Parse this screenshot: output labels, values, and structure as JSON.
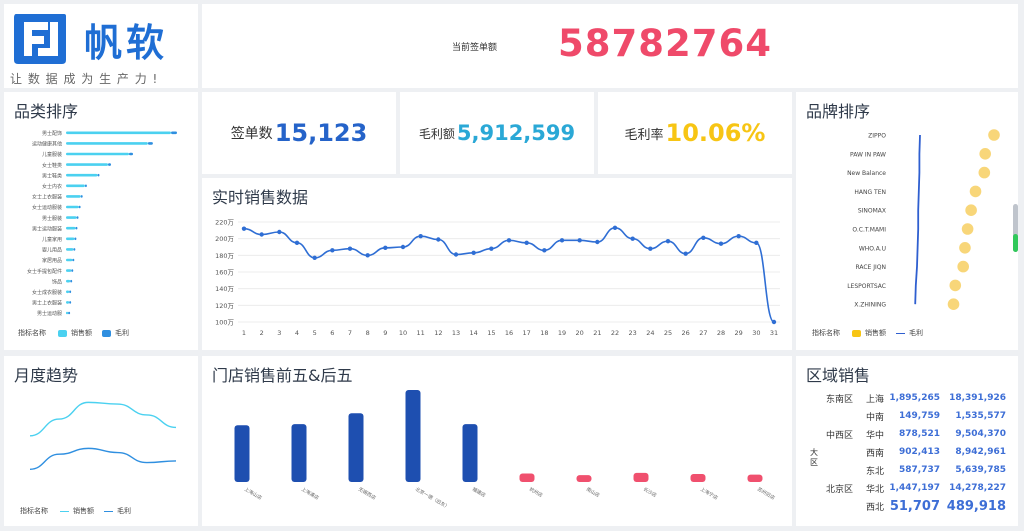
{
  "logo": {
    "brand": "帆软",
    "slogan": "让 数 据 成 为 生 产 力 !"
  },
  "header": {
    "label": "当前签单额",
    "value": "58782764"
  },
  "kpis": {
    "orders_label": "签单数",
    "orders_value": "15,123",
    "profit_label": "毛利额",
    "profit_value": "5,912,599",
    "margin_label": "毛利率",
    "margin_value": "10.06%"
  },
  "category_rank": {
    "title": "品类排序",
    "categories": [
      "男士配饰",
      "运动健康其他",
      "儿童服装",
      "女士鞋类",
      "男士鞋类",
      "女士内衣",
      "女士上衣服装",
      "女士运动服装",
      "男士服装",
      "男士运动服装",
      "儿童家用",
      "婴儿用品",
      "家居用品",
      "女士手提包配件",
      "饰品",
      "女士成衣服装",
      "男士上衣服装",
      "男士运动服"
    ],
    "legend_title": "指标名称",
    "legend_sales": "销售额",
    "legend_profit": "毛利"
  },
  "realtime": {
    "title": "实时销售数据",
    "y_ticks": [
      "220万",
      "200万",
      "180万",
      "160万",
      "140万",
      "120万",
      "100万"
    ],
    "x_ticks": [
      "1",
      "2",
      "3",
      "4",
      "5",
      "6",
      "7",
      "8",
      "9",
      "10",
      "11",
      "12",
      "13",
      "14",
      "15",
      "16",
      "17",
      "18",
      "19",
      "20",
      "21",
      "22",
      "23",
      "24",
      "25",
      "26",
      "27",
      "28",
      "29",
      "30",
      "31"
    ]
  },
  "brand_rank": {
    "title": "品牌排序",
    "brands": [
      "ZIPPO",
      "PAW IN PAW",
      "New Balance",
      "HANG TEN",
      "SINOMAX",
      "O.C.T.MAMI",
      "WHO.A.U",
      "RACE JIQN",
      "LESPORTSAC",
      "X.ZHINING"
    ],
    "legend_title": "指标名称",
    "legend_sales": "销售额",
    "legend_profit": "毛利"
  },
  "monthly": {
    "title": "月度趋势",
    "legend_title": "指标名称",
    "legend_sales": "销售额",
    "legend_profit": "毛利"
  },
  "stores": {
    "title": "门店销售前五&后五",
    "labels": [
      "上海山店",
      "上海浦店",
      "无锡西店",
      "北京一德（旧东）",
      "福建店",
      "杭州店",
      "南山店",
      "长沙店",
      "上海宁店",
      "苏州旧店"
    ]
  },
  "regions": {
    "title": "区域销售",
    "axis_label": "大区",
    "rows": [
      {
        "region": "东南区",
        "prov": "上海",
        "v1": "1,895,265",
        "v2": "18,391,926"
      },
      {
        "region": "",
        "prov": "中南",
        "v1": "149,759",
        "v2": "1,535,577"
      },
      {
        "region": "中西区",
        "prov": "华中",
        "v1": "878,521",
        "v2": "9,504,370"
      },
      {
        "region": "",
        "prov": "西南",
        "v1": "902,413",
        "v2": "8,942,961"
      },
      {
        "region": "",
        "prov": "东北",
        "v1": "587,737",
        "v2": "5,639,785"
      },
      {
        "region": "北京区",
        "prov": "华北",
        "v1": "1,447,197",
        "v2": "14,278,227"
      },
      {
        "region": "",
        "prov": "西北",
        "v1": "51,707",
        "v2": "489,918"
      }
    ]
  },
  "chart_data": [
    {
      "type": "bar",
      "title": "品类排序",
      "categories": [
        "男士配饰",
        "运动健康其他",
        "儿童服装",
        "女士鞋类",
        "男士鞋类",
        "女士内衣",
        "女士上衣服装",
        "女士运动服装",
        "男士服装",
        "男士运动服装",
        "儿童家用",
        "婴儿用品",
        "家居用品",
        "女士手提包配件",
        "饰品",
        "女士成衣服装",
        "男士上衣服装",
        "男士运动服"
      ],
      "series": [
        {
          "name": "销售额",
          "values": [
            100,
            78,
            60,
            40,
            30,
            18,
            14,
            12,
            10,
            9,
            8,
            7,
            6,
            5,
            4,
            3,
            3,
            2
          ]
        },
        {
          "name": "毛利",
          "values": [
            6,
            5,
            4,
            3,
            2,
            2,
            2,
            1,
            1,
            1,
            1,
            1,
            1,
            1,
            1,
            1,
            1,
            1
          ]
        }
      ]
    },
    {
      "type": "line",
      "title": "实时销售数据",
      "x": [
        1,
        2,
        3,
        4,
        5,
        6,
        7,
        8,
        9,
        10,
        11,
        12,
        13,
        14,
        15,
        16,
        17,
        18,
        19,
        20,
        21,
        22,
        23,
        24,
        25,
        26,
        27,
        28,
        29,
        30,
        31
      ],
      "values": [
        212,
        205,
        208,
        195,
        177,
        186,
        188,
        180,
        189,
        190,
        203,
        199,
        181,
        183,
        188,
        198,
        195,
        186,
        198,
        198,
        196,
        213,
        200,
        188,
        197,
        182,
        201,
        194,
        203,
        195,
        100
      ],
      "unit": "万",
      "ylim": [
        100,
        220
      ]
    },
    {
      "type": "scatter",
      "title": "品牌排序",
      "categories": [
        "ZIPPO",
        "PAW IN PAW",
        "New Balance",
        "HANG TEN",
        "SINOMAX",
        "O.C.T.MAMI",
        "WHO.A.U",
        "RACE JIQN",
        "LESPORTSAC",
        "X.ZHINING"
      ],
      "series": [
        {
          "name": "销售额",
          "values": [
            100,
            80,
            78,
            58,
            48,
            40,
            34,
            30,
            12,
            8
          ]
        },
        {
          "name": "毛利",
          "values": [
            10,
            9,
            9,
            8,
            7,
            7,
            6,
            5,
            3,
            2
          ]
        }
      ]
    },
    {
      "type": "line",
      "title": "月度趋势",
      "series": [
        {
          "name": "销售额",
          "values": [
            60,
            80,
            100,
            98,
            85,
            70
          ]
        },
        {
          "name": "毛利",
          "values": [
            20,
            38,
            45,
            40,
            28,
            30
          ]
        }
      ]
    },
    {
      "type": "bar",
      "title": "门店销售前五&后五",
      "categories": [
        "上海山店",
        "上海浦店",
        "无锡西店",
        "北京一德（旧东）",
        "福建店",
        "杭州店",
        "南山店",
        "长沙店",
        "上海宁店",
        "苏州旧店"
      ],
      "values": [
        100,
        102,
        121,
        162,
        102,
        15,
        12,
        16,
        14,
        13
      ]
    }
  ]
}
